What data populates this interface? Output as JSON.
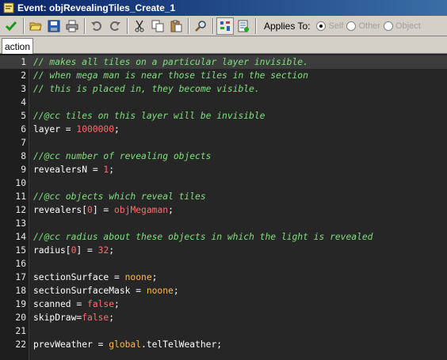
{
  "window": {
    "title": "Event: objRevealingTiles_Create_1"
  },
  "toolbar": {
    "buttons": [
      {
        "name": "ok-button",
        "icon": "check-icon"
      },
      {
        "name": "open-button",
        "icon": "folder-icon"
      },
      {
        "name": "save-button",
        "icon": "floppy-icon"
      },
      {
        "name": "print-button",
        "icon": "printer-icon"
      },
      {
        "name": "undo-button",
        "icon": "undo-icon"
      },
      {
        "name": "redo-button",
        "icon": "redo-icon"
      },
      {
        "name": "cut-button",
        "icon": "scissors-icon"
      },
      {
        "name": "copy-button",
        "icon": "copy-icon"
      },
      {
        "name": "paste-button",
        "icon": "paste-icon"
      },
      {
        "name": "find-button",
        "icon": "magnifier-icon"
      },
      {
        "name": "syntax-check-button",
        "icon": "syntax-icon",
        "pressed": true
      },
      {
        "name": "code-complete-button",
        "icon": "document-icon"
      }
    ],
    "applies_to_label": "Applies To:",
    "applies_options": [
      "Self",
      "Other",
      "Object"
    ],
    "applies_selected": "Self"
  },
  "tabs": [
    {
      "label": "action"
    }
  ],
  "editor": {
    "current_line": 1,
    "lines": [
      {
        "n": "1",
        "segs": [
          {
            "t": "// makes all tiles on a particular layer invisible.",
            "c": "com"
          }
        ]
      },
      {
        "n": "2",
        "segs": [
          {
            "t": "// when mega man is near those tiles in the section",
            "c": "com"
          }
        ]
      },
      {
        "n": "3",
        "segs": [
          {
            "t": "// this is placed in, they become visible.",
            "c": "com"
          }
        ]
      },
      {
        "n": "4",
        "segs": []
      },
      {
        "n": "5",
        "segs": [
          {
            "t": "//@cc tiles on this layer will be invisible",
            "c": "com"
          }
        ]
      },
      {
        "n": "6",
        "segs": [
          {
            "t": "layer = ",
            "c": "wht"
          },
          {
            "t": "1000000",
            "c": "num"
          },
          {
            "t": ";",
            "c": "wht"
          }
        ]
      },
      {
        "n": "7",
        "segs": []
      },
      {
        "n": "8",
        "segs": [
          {
            "t": "//@cc number of revealing objects",
            "c": "com"
          }
        ]
      },
      {
        "n": "9",
        "segs": [
          {
            "t": "revealersN = ",
            "c": "wht"
          },
          {
            "t": "1",
            "c": "num"
          },
          {
            "t": ";",
            "c": "wht"
          }
        ]
      },
      {
        "n": "10",
        "segs": []
      },
      {
        "n": "11",
        "segs": [
          {
            "t": "//@cc objects which reveal tiles",
            "c": "com"
          }
        ]
      },
      {
        "n": "12",
        "segs": [
          {
            "t": "revealers[",
            "c": "wht"
          },
          {
            "t": "0",
            "c": "num"
          },
          {
            "t": "] = ",
            "c": "wht"
          },
          {
            "t": "objMegaman",
            "c": "obj"
          },
          {
            "t": ";",
            "c": "wht"
          }
        ]
      },
      {
        "n": "13",
        "segs": []
      },
      {
        "n": "14",
        "segs": [
          {
            "t": "//@cc radius about these objects in which the light is revealed",
            "c": "com"
          }
        ]
      },
      {
        "n": "15",
        "segs": [
          {
            "t": "radius[",
            "c": "wht"
          },
          {
            "t": "0",
            "c": "num"
          },
          {
            "t": "] = ",
            "c": "wht"
          },
          {
            "t": "32",
            "c": "num"
          },
          {
            "t": ";",
            "c": "wht"
          }
        ]
      },
      {
        "n": "16",
        "segs": []
      },
      {
        "n": "17",
        "segs": [
          {
            "t": "sectionSurface = ",
            "c": "wht"
          },
          {
            "t": "noone",
            "c": "kw"
          },
          {
            "t": ";",
            "c": "wht"
          }
        ]
      },
      {
        "n": "18",
        "segs": [
          {
            "t": "sectionSurfaceMask = ",
            "c": "wht"
          },
          {
            "t": "noone",
            "c": "kw"
          },
          {
            "t": ";",
            "c": "wht"
          }
        ]
      },
      {
        "n": "19",
        "segs": [
          {
            "t": "scanned = ",
            "c": "wht"
          },
          {
            "t": "false",
            "c": "num"
          },
          {
            "t": ";",
            "c": "wht"
          }
        ]
      },
      {
        "n": "20",
        "segs": [
          {
            "t": "skipDraw=",
            "c": "wht"
          },
          {
            "t": "false",
            "c": "num"
          },
          {
            "t": ";",
            "c": "wht"
          }
        ]
      },
      {
        "n": "21",
        "segs": []
      },
      {
        "n": "22",
        "segs": [
          {
            "t": "prevWeather = ",
            "c": "wht"
          },
          {
            "t": "global",
            "c": "kw"
          },
          {
            "t": ".telTelWeather;",
            "c": "wht"
          }
        ]
      }
    ]
  }
}
